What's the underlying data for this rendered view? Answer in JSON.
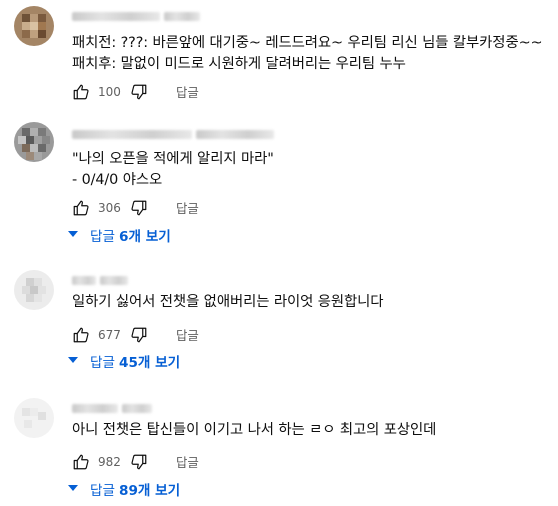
{
  "comments": [
    {
      "lines": [
        "패치전: ???: 바른앞에 대기중~ 레드드려요~ 우리팀 리신 님들 칼부카정중~~",
        "패치후: 말없이 미드로 시원하게 달려버리는 우리팀 누누"
      ],
      "likes": "100",
      "reply_label": "답글",
      "avatar_color": "#a08060"
    },
    {
      "lines": [
        "\"나의 오픈을 적에게 알리지 마라\"",
        "- 0/4/0 야스오"
      ],
      "likes": "306",
      "reply_label": "답글",
      "replies_prefix": "답글",
      "replies_count": "6개 보기",
      "avatar_color": "#8a8a8a"
    },
    {
      "lines": [
        "일하기 싫어서 전챗을 없애버리는 라이엇 응원합니다"
      ],
      "likes": "677",
      "reply_label": "답글",
      "replies_prefix": "답글",
      "replies_count": "45개 보기",
      "avatar_color": "#d8d8d8"
    },
    {
      "lines": [
        "아니 전챗은 탑신들이 이기고 나서 하는 ㄹㅇ 최고의 포상인데"
      ],
      "likes": "982",
      "reply_label": "답글",
      "replies_prefix": "답글",
      "replies_count": "89개 보기",
      "avatar_color": "#e6e6e6"
    }
  ],
  "colors": {
    "link": "#065fd4",
    "muted": "#606060",
    "text": "#0f0f0f"
  }
}
